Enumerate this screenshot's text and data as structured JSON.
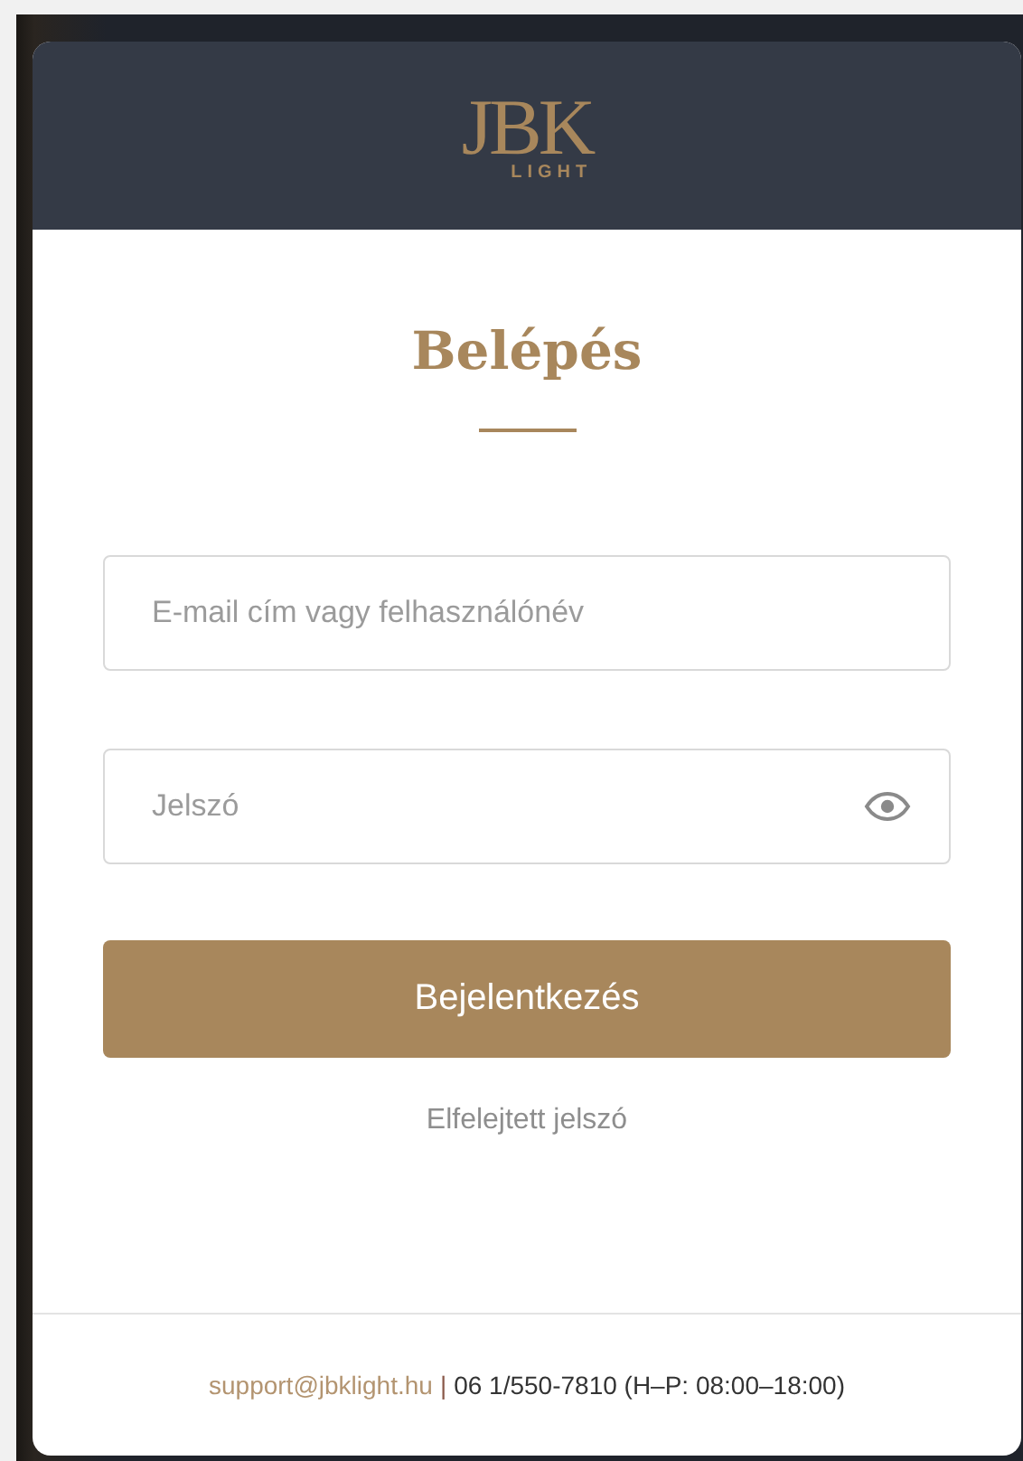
{
  "logo": {
    "mark": "JBK",
    "sub": "LIGHT"
  },
  "title": "Belépés",
  "fields": [
    {
      "kind": "text",
      "placeholder": "E-mail cím vagy felhasználónév"
    },
    {
      "kind": "password",
      "placeholder": "Jelszó"
    }
  ],
  "submit": "Bejelentkezés",
  "forgot_link": "Elfelejtett jelszó",
  "footer": {
    "email": "support@jbklight.hu",
    "separator": "|",
    "contact": "06 1/550-7810 (H–P: 08:00–18:00)"
  }
}
